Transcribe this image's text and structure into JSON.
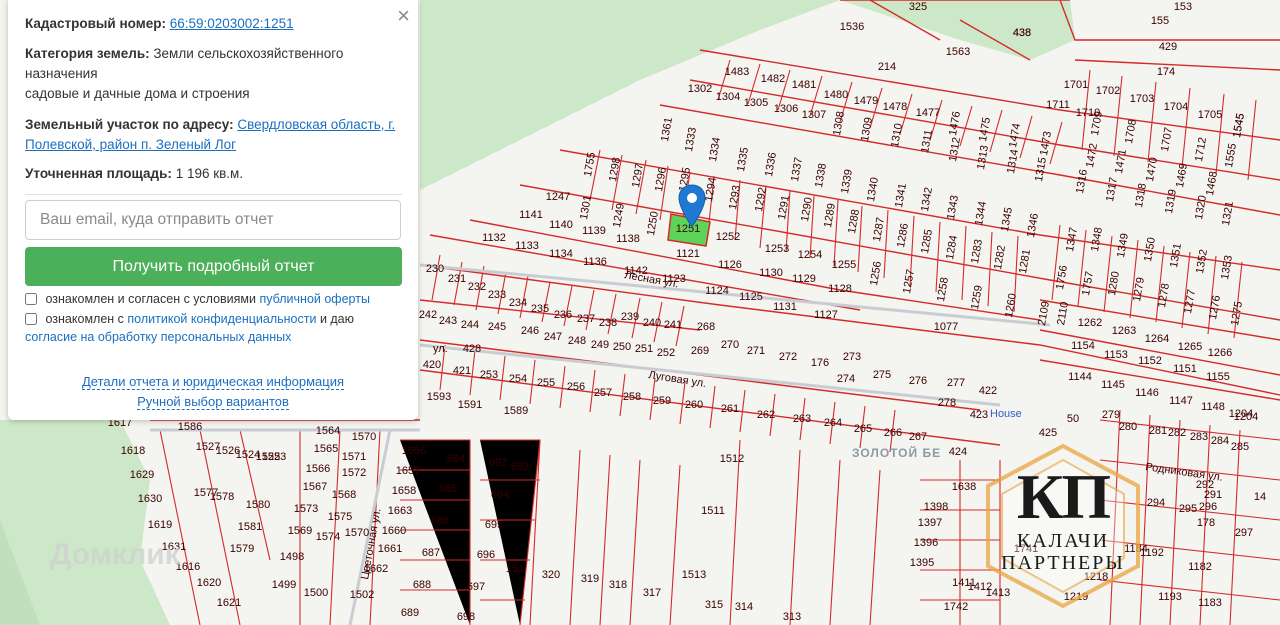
{
  "info_panel": {
    "cadastral_label": "Кадастровый номер:",
    "cadastral_value": "66:59:0203002:1251",
    "category_label": "Категория земель:",
    "category_value": "Земли сельскохозяйственного назначения",
    "usage_value": "садовые и дачные дома и строения",
    "address_label": "Земельный участок по адресу:",
    "address_value": "Свердловская область, г. Полевской, район п. Зеленый Лог",
    "area_label": "Уточненная площадь:",
    "area_value": "1 196 кв.м.",
    "email_placeholder": "Ваш email, куда отправить отчет",
    "submit_label": "Получить подробный отчет",
    "consent1_text": "ознакомлен и согласен с условиями",
    "consent1_link": "публичной оферты",
    "consent2_text_a": "ознакомлен с",
    "consent2_link_a": "политикой конфиденциальности",
    "consent2_text_b": "и даю",
    "consent2_link_b": "согласие на обработку персональных данных",
    "details_link": "Детали отчета и юридическая информация",
    "manual_link": "Ручной выбор вариантов",
    "close_symbol": "×"
  },
  "map": {
    "streets": [
      "Лесная ул.",
      "Луговая ул.",
      "ул.",
      "Цветочная ул.",
      "Родниковая ул."
    ],
    "places": [
      "ЗОЛОТОЙ БЕ",
      "House"
    ],
    "selected_plot": "1251",
    "watermark": "Домклик",
    "plot_labels": [
      [
        "325",
        918,
        10
      ],
      [
        "153",
        1183,
        10
      ],
      [
        "155",
        1160,
        24
      ],
      [
        "1536",
        852,
        30
      ],
      [
        "438",
        1022,
        36
      ],
      [
        "1563",
        958,
        55
      ],
      [
        "429",
        1168,
        50
      ],
      [
        "214",
        887,
        70
      ],
      [
        "174",
        1166,
        75
      ],
      [
        "1483",
        737,
        75
      ],
      [
        "1482",
        773,
        82
      ],
      [
        "1481",
        804,
        88
      ],
      [
        "1480",
        836,
        98
      ],
      [
        "1479",
        866,
        104
      ],
      [
        "1478",
        895,
        110
      ],
      [
        "1477",
        928,
        116
      ],
      [
        "1476",
        958,
        124
      ],
      [
        "1475",
        988,
        130
      ],
      [
        "1474",
        1018,
        136
      ],
      [
        "1473",
        1049,
        144
      ],
      [
        "1701",
        1076,
        88
      ],
      [
        "1702",
        1108,
        94
      ],
      [
        "1703",
        1142,
        102
      ],
      [
        "1704",
        1176,
        110
      ],
      [
        "1705",
        1210,
        118
      ],
      [
        "1545",
        1242,
        126
      ],
      [
        "1302",
        700,
        92
      ],
      [
        "1304",
        728,
        100
      ],
      [
        "1305",
        756,
        106
      ],
      [
        "1306",
        786,
        112
      ],
      [
        "1307",
        814,
        118
      ],
      [
        "1308",
        842,
        124
      ],
      [
        "1309",
        870,
        130
      ],
      [
        "1310",
        900,
        136
      ],
      [
        "1311",
        930,
        142
      ],
      [
        "1312",
        958,
        150
      ],
      [
        "1313",
        986,
        158
      ],
      [
        "1314",
        1016,
        162
      ],
      [
        "1315",
        1044,
        170
      ],
      [
        "1711",
        1058,
        108
      ],
      [
        "1710",
        1088,
        116
      ],
      [
        "1709",
        1100,
        124
      ],
      [
        "1708",
        1134,
        132
      ],
      [
        "1707",
        1170,
        140
      ],
      [
        "1712",
        1204,
        150
      ],
      [
        "1555",
        1234,
        156
      ],
      [
        "1472",
        1095,
        156
      ],
      [
        "1471",
        1124,
        162
      ],
      [
        "1470",
        1155,
        170
      ],
      [
        "1469",
        1185,
        176
      ],
      [
        "1468",
        1215,
        184
      ],
      [
        "1316",
        1085,
        182
      ],
      [
        "1317",
        1115,
        190
      ],
      [
        "1318",
        1144,
        196
      ],
      [
        "1319",
        1174,
        202
      ],
      [
        "1320",
        1204,
        208
      ],
      [
        "1321",
        1231,
        214
      ],
      [
        "1361",
        670,
        130
      ],
      [
        "1333",
        694,
        140
      ],
      [
        "1334",
        718,
        150
      ],
      [
        "1335",
        746,
        160
      ],
      [
        "1755",
        593,
        165
      ],
      [
        "1298",
        618,
        170
      ],
      [
        "1297",
        641,
        176
      ],
      [
        "1296",
        664,
        180
      ],
      [
        "1295",
        688,
        180
      ],
      [
        "1294",
        714,
        190
      ],
      [
        "1293",
        738,
        198
      ],
      [
        "1292",
        764,
        200
      ],
      [
        "1291",
        787,
        208
      ],
      [
        "1290",
        810,
        210
      ],
      [
        "1289",
        833,
        216
      ],
      [
        "1288",
        857,
        222
      ],
      [
        "1336",
        774,
        165
      ],
      [
        "1337",
        800,
        170
      ],
      [
        "1338",
        824,
        176
      ],
      [
        "1339",
        850,
        182
      ],
      [
        "1340",
        876,
        190
      ],
      [
        "1341",
        904,
        196
      ],
      [
        "1342",
        930,
        200
      ],
      [
        "1343",
        956,
        208
      ],
      [
        "1344",
        984,
        214
      ],
      [
        "1345",
        1010,
        220
      ],
      [
        "1346",
        1036,
        226
      ],
      [
        "1287",
        882,
        230
      ],
      [
        "1286",
        906,
        236
      ],
      [
        "1285",
        930,
        242
      ],
      [
        "1284",
        955,
        248
      ],
      [
        "1283",
        980,
        252
      ],
      [
        "1282",
        1003,
        258
      ],
      [
        "1281",
        1028,
        262
      ],
      [
        "1347",
        1075,
        240
      ],
      [
        "1348",
        1100,
        240
      ],
      [
        "1349",
        1126,
        246
      ],
      [
        "1350",
        1153,
        250
      ],
      [
        "1351",
        1179,
        256
      ],
      [
        "1352",
        1205,
        262
      ],
      [
        "1353",
        1230,
        268
      ],
      [
        "1756",
        1065,
        278
      ],
      [
        "1757",
        1091,
        284
      ],
      [
        "1280",
        1117,
        284
      ],
      [
        "1279",
        1142,
        290
      ],
      [
        "1278",
        1167,
        296
      ],
      [
        "1277",
        1193,
        302
      ],
      [
        "1276",
        1218,
        308
      ],
      [
        "1275",
        1240,
        314
      ],
      [
        "1247",
        558,
        200
      ],
      [
        "1301",
        589,
        208
      ],
      [
        "1249",
        622,
        216
      ],
      [
        "1250",
        656,
        224
      ],
      [
        "1251",
        688,
        232
      ],
      [
        "1252",
        728,
        240
      ],
      [
        "1141",
        531,
        218
      ],
      [
        "1140",
        561,
        228
      ],
      [
        "1139",
        594,
        234
      ],
      [
        "1138",
        628,
        242
      ],
      [
        "1132",
        494,
        241
      ],
      [
        "1133",
        527,
        249
      ],
      [
        "1134",
        561,
        257
      ],
      [
        "1136",
        595,
        265
      ],
      [
        "1142",
        636,
        274
      ],
      [
        "1121",
        688,
        257
      ],
      [
        "1126",
        730,
        268
      ],
      [
        "1253",
        777,
        252
      ],
      [
        "1254",
        810,
        258
      ],
      [
        "1255",
        844,
        268
      ],
      [
        "1256",
        879,
        274
      ],
      [
        "1257",
        912,
        282
      ],
      [
        "1258",
        946,
        290
      ],
      [
        "1259",
        980,
        298
      ],
      [
        "1260",
        1014,
        306
      ],
      [
        "1130",
        771,
        276
      ],
      [
        "1129",
        804,
        282
      ],
      [
        "1128",
        840,
        292
      ],
      [
        "1123",
        674,
        282
      ],
      [
        "1124",
        717,
        294
      ],
      [
        "1125",
        751,
        300
      ],
      [
        "1131",
        785,
        310
      ],
      [
        "1127",
        826,
        318
      ],
      [
        "1077",
        946,
        330
      ],
      [
        "2109",
        1047,
        314
      ],
      [
        "2110",
        1066,
        314
      ],
      [
        "1262",
        1090,
        326
      ],
      [
        "1263",
        1124,
        334
      ],
      [
        "1264",
        1157,
        342
      ],
      [
        "1265",
        1190,
        350
      ],
      [
        "1266",
        1220,
        356
      ],
      [
        "1154",
        1083,
        349
      ],
      [
        "1153",
        1116,
        358
      ],
      [
        "1152",
        1150,
        364
      ],
      [
        "1151",
        1185,
        372
      ],
      [
        "1155",
        1218,
        380
      ],
      [
        "1144",
        1080,
        380
      ],
      [
        "1145",
        1113,
        388
      ],
      [
        "1146",
        1147,
        396
      ],
      [
        "1147",
        1181,
        404
      ],
      [
        "1148",
        1213,
        410
      ],
      [
        "1204",
        1241,
        417
      ],
      [
        "230",
        435,
        272
      ],
      [
        "231",
        457,
        282
      ],
      [
        "232",
        477,
        290
      ],
      [
        "233",
        497,
        298
      ],
      [
        "234",
        518,
        306
      ],
      [
        "235",
        540,
        312
      ],
      [
        "236",
        563,
        318
      ],
      [
        "237",
        586,
        322
      ],
      [
        "238",
        608,
        326
      ],
      [
        "242",
        428,
        318
      ],
      [
        "243",
        448,
        324
      ],
      [
        "244",
        470,
        328
      ],
      [
        "245",
        497,
        330
      ],
      [
        "246",
        530,
        334
      ],
      [
        "247",
        553,
        340
      ],
      [
        "248",
        577,
        344
      ],
      [
        "249",
        600,
        348
      ],
      [
        "250",
        622,
        350
      ],
      [
        "251",
        644,
        352
      ],
      [
        "252",
        666,
        356
      ],
      [
        "239",
        630,
        320
      ],
      [
        "240",
        652,
        326
      ],
      [
        "241",
        673,
        328
      ],
      [
        "268",
        706,
        330
      ],
      [
        "269",
        700,
        354
      ],
      [
        "270",
        730,
        348
      ],
      [
        "271",
        756,
        354
      ],
      [
        "272",
        788,
        360
      ],
      [
        "176",
        820,
        366
      ],
      [
        "273",
        852,
        360
      ],
      [
        "274",
        846,
        382
      ],
      [
        "275",
        882,
        378
      ],
      [
        "276",
        918,
        384
      ],
      [
        "277",
        956,
        386
      ],
      [
        "278",
        947,
        406
      ],
      [
        "422",
        988,
        394
      ],
      [
        "428",
        472,
        352
      ],
      [
        "420",
        432,
        368
      ],
      [
        "421",
        462,
        374
      ],
      [
        "253",
        489,
        378
      ],
      [
        "254",
        518,
        382
      ],
      [
        "255",
        546,
        386
      ],
      [
        "256",
        576,
        390
      ],
      [
        "257",
        603,
        396
      ],
      [
        "258",
        632,
        400
      ],
      [
        "259",
        662,
        404
      ],
      [
        "260",
        694,
        408
      ],
      [
        "261",
        730,
        412
      ],
      [
        "262",
        766,
        418
      ],
      [
        "263",
        802,
        422
      ],
      [
        "264",
        833,
        426
      ],
      [
        "265",
        863,
        432
      ],
      [
        "266",
        893,
        436
      ],
      [
        "267",
        918,
        440
      ],
      [
        "424",
        958,
        455
      ],
      [
        "423",
        979,
        418
      ],
      [
        "425",
        1048,
        436
      ],
      [
        "1593",
        439,
        400
      ],
      [
        "1591",
        470,
        408
      ],
      [
        "1589",
        516,
        414
      ],
      [
        "1617",
        120,
        426
      ],
      [
        "1586",
        190,
        430
      ],
      [
        "1618",
        133,
        454
      ],
      [
        "1629",
        142,
        478
      ],
      [
        "1630",
        150,
        502
      ],
      [
        "1619",
        160,
        528
      ],
      [
        "1631",
        174,
        550
      ],
      [
        "1616",
        188,
        570
      ],
      [
        "1620",
        209,
        586
      ],
      [
        "1621",
        229,
        606
      ],
      [
        "1527",
        208,
        450
      ],
      [
        "1526",
        228,
        454
      ],
      [
        "1524",
        248,
        458
      ],
      [
        "1525",
        268,
        460
      ],
      [
        "1523",
        274,
        460
      ],
      [
        "1564",
        328,
        434
      ],
      [
        "1570",
        364,
        440
      ],
      [
        "1565",
        326,
        452
      ],
      [
        "1571",
        354,
        460
      ],
      [
        "1566",
        318,
        472
      ],
      [
        "1572",
        354,
        476
      ],
      [
        "1567",
        315,
        490
      ],
      [
        "1568",
        344,
        498
      ],
      [
        "1573",
        306,
        512
      ],
      [
        "1575",
        340,
        520
      ],
      [
        "1574",
        328,
        540
      ],
      [
        "1569",
        300,
        534
      ],
      [
        "1570",
        357,
        536
      ],
      [
        "1580",
        258,
        508
      ],
      [
        "1581",
        250,
        530
      ],
      [
        "1579",
        242,
        552
      ],
      [
        "1578",
        222,
        500
      ],
      [
        "1577",
        206,
        496
      ],
      [
        "1498",
        292,
        560
      ],
      [
        "1499",
        284,
        588
      ],
      [
        "1500",
        316,
        596
      ],
      [
        "1656",
        414,
        454
      ],
      [
        "1657",
        408,
        474
      ],
      [
        "1658",
        404,
        494
      ],
      [
        "1663",
        400,
        514
      ],
      [
        "1660",
        394,
        534
      ],
      [
        "1661",
        390,
        552
      ],
      [
        "1662",
        376,
        572
      ],
      [
        "1502",
        362,
        598
      ],
      [
        "684",
        456,
        462
      ],
      [
        "685",
        448,
        492
      ],
      [
        "686",
        440,
        524
      ],
      [
        "687",
        431,
        556
      ],
      [
        "688",
        422,
        588
      ],
      [
        "689",
        410,
        616
      ],
      [
        "692",
        498,
        466
      ],
      [
        "693",
        520,
        470
      ],
      [
        "694",
        500,
        498
      ],
      [
        "695",
        494,
        528
      ],
      [
        "696",
        486,
        558
      ],
      [
        "697",
        476,
        590
      ],
      [
        "698",
        466,
        620
      ],
      [
        "151",
        515,
        572
      ],
      [
        "320",
        551,
        578
      ],
      [
        "319",
        590,
        582
      ],
      [
        "318",
        618,
        588
      ],
      [
        "317",
        652,
        596
      ],
      [
        "1512",
        732,
        462
      ],
      [
        "1511",
        713,
        514
      ],
      [
        "1513",
        694,
        578
      ],
      [
        "315",
        714,
        608
      ],
      [
        "314",
        744,
        610
      ],
      [
        "313",
        792,
        620
      ],
      [
        "50",
        1073,
        422
      ],
      [
        "279",
        1111,
        418
      ],
      [
        "280",
        1128,
        430
      ],
      [
        "281",
        1158,
        434
      ],
      [
        "282",
        1177,
        436
      ],
      [
        "283",
        1199,
        440
      ],
      [
        "284",
        1220,
        444
      ],
      [
        "285",
        1240,
        450
      ],
      [
        "1638",
        964,
        490
      ],
      [
        "1398",
        936,
        510
      ],
      [
        "1397",
        930,
        526
      ],
      [
        "1396",
        926,
        546
      ],
      [
        "1395",
        922,
        566
      ],
      [
        "1411",
        964,
        586
      ],
      [
        "1412",
        980,
        590
      ],
      [
        "1413",
        998,
        596
      ],
      [
        "1741",
        1026,
        552
      ],
      [
        "1742",
        956,
        610
      ],
      [
        "1184",
        1136,
        552
      ],
      [
        "1192",
        1152,
        556
      ],
      [
        "1182",
        1200,
        570
      ],
      [
        "1183",
        1210,
        606
      ],
      [
        "1193",
        1170,
        600
      ],
      [
        "294",
        1156,
        506
      ],
      [
        "295",
        1188,
        512
      ],
      [
        "296",
        1208,
        510
      ],
      [
        "297",
        1244,
        536
      ],
      [
        "178",
        1206,
        526
      ],
      [
        "291",
        1213,
        498
      ],
      [
        "292",
        1205,
        488
      ],
      [
        "14",
        1260,
        500
      ],
      [
        "1218",
        1096,
        580
      ],
      [
        "1219",
        1076,
        600
      ],
      [
        "1204",
        1246,
        420
      ],
      [
        "438",
        1022,
        36
      ],
      [
        "1545",
        1242,
        126
      ]
    ]
  }
}
